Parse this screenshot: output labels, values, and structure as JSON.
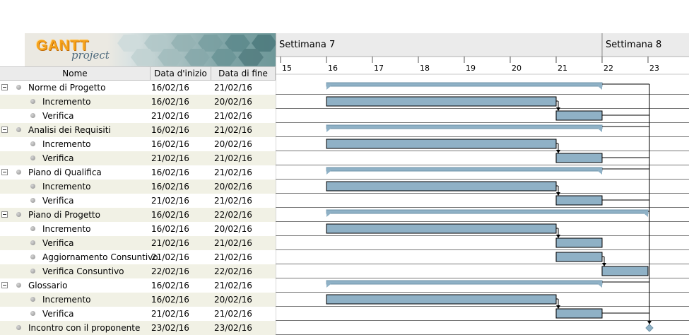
{
  "logo": {
    "brand": "GANTT",
    "sub": "project"
  },
  "columns": {
    "name": "Nome",
    "start": "Data d'inizio",
    "end": "Data di fine"
  },
  "timeline": {
    "weeks": [
      {
        "label": "Settimana  7",
        "day": 15
      },
      {
        "label": "Settimana  8",
        "day": 22
      }
    ],
    "days": [
      "15",
      "16",
      "17",
      "18",
      "19",
      "20",
      "21",
      "22",
      "23"
    ]
  },
  "tasks": [
    {
      "name": "Norme di Progetto",
      "start": "16/02/16",
      "end": "21/02/16",
      "level": 0,
      "summary": true
    },
    {
      "name": "Incremento",
      "start": "16/02/16",
      "end": "20/02/16",
      "level": 1
    },
    {
      "name": "Verifica",
      "start": "21/02/16",
      "end": "21/02/16",
      "level": 1
    },
    {
      "name": "Analisi dei Requisiti",
      "start": "16/02/16",
      "end": "21/02/16",
      "level": 0,
      "summary": true
    },
    {
      "name": "Incremento",
      "start": "16/02/16",
      "end": "20/02/16",
      "level": 1
    },
    {
      "name": "Verifica",
      "start": "21/02/16",
      "end": "21/02/16",
      "level": 1
    },
    {
      "name": "Piano di Qualifica",
      "start": "16/02/16",
      "end": "21/02/16",
      "level": 0,
      "summary": true
    },
    {
      "name": "Incremento",
      "start": "16/02/16",
      "end": "20/02/16",
      "level": 1
    },
    {
      "name": "Verifica",
      "start": "21/02/16",
      "end": "21/02/16",
      "level": 1
    },
    {
      "name": "Piano di Progetto",
      "start": "16/02/16",
      "end": "22/02/16",
      "level": 0,
      "summary": true
    },
    {
      "name": "Incremento",
      "start": "16/02/16",
      "end": "20/02/16",
      "level": 1
    },
    {
      "name": "Verifica",
      "start": "21/02/16",
      "end": "21/02/16",
      "level": 1
    },
    {
      "name": "Aggiornamento Consuntivo",
      "start": "21/02/16",
      "end": "21/02/16",
      "level": 1
    },
    {
      "name": "Verifica Consuntivo",
      "start": "22/02/16",
      "end": "22/02/16",
      "level": 1
    },
    {
      "name": "Glossario",
      "start": "16/02/16",
      "end": "21/02/16",
      "level": 0,
      "summary": true
    },
    {
      "name": "Incremento",
      "start": "16/02/16",
      "end": "20/02/16",
      "level": 1
    },
    {
      "name": "Verifica",
      "start": "21/02/16",
      "end": "21/02/16",
      "level": 1
    },
    {
      "name": "Incontro con il proponente",
      "start": "23/02/16",
      "end": "23/02/16",
      "level": 0,
      "milestone": true
    }
  ],
  "colors": {
    "bar": "#8fb1c6",
    "summary": "#8fb1c6",
    "alt_row": "#f1f1e5",
    "header": "#ebebeb",
    "brand": "#f5a21c"
  }
}
